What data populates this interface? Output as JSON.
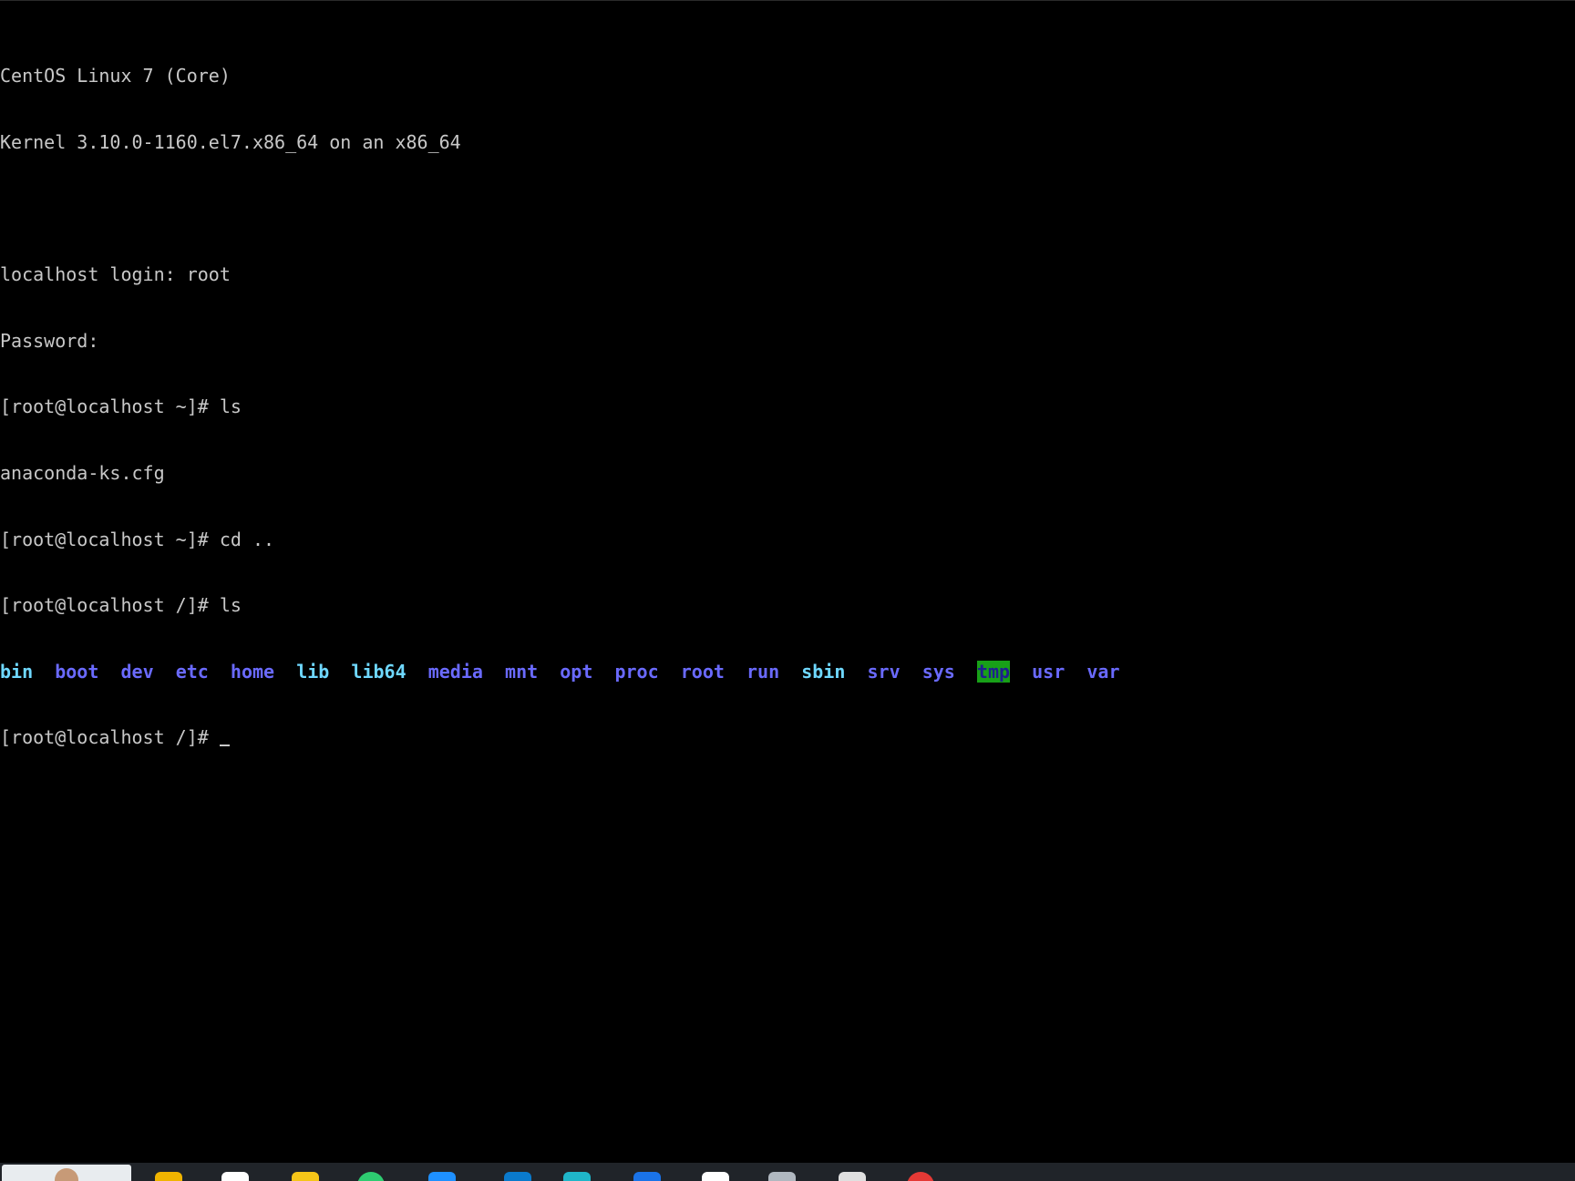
{
  "console": {
    "lines": [
      "CentOS Linux 7 (Core)",
      "Kernel 3.10.0-1160.el7.x86_64 on an x86_64",
      "",
      "localhost login: root",
      "Password:",
      "[root@localhost ~]# ls",
      "anaconda-ks.cfg",
      "[root@localhost ~]# cd ..",
      "[root@localhost /]# ls"
    ],
    "ls_entries": [
      {
        "name": "bin",
        "color": "#6fd8ff"
      },
      {
        "name": "boot",
        "color": "#6a6aff"
      },
      {
        "name": "dev",
        "color": "#6a6aff"
      },
      {
        "name": "etc",
        "color": "#6a6aff"
      },
      {
        "name": "home",
        "color": "#6a6aff"
      },
      {
        "name": "lib",
        "color": "#6fd8ff"
      },
      {
        "name": "lib64",
        "color": "#6fd8ff"
      },
      {
        "name": "media",
        "color": "#6a6aff"
      },
      {
        "name": "mnt",
        "color": "#6a6aff"
      },
      {
        "name": "opt",
        "color": "#6a6aff"
      },
      {
        "name": "proc",
        "color": "#6a6aff"
      },
      {
        "name": "root",
        "color": "#6a6aff"
      },
      {
        "name": "run",
        "color": "#6a6aff"
      },
      {
        "name": "sbin",
        "color": "#6fd8ff"
      },
      {
        "name": "srv",
        "color": "#6a6aff"
      },
      {
        "name": "sys",
        "color": "#6a6aff"
      },
      {
        "name": "tmp",
        "color": "#1f1f8f",
        "background": "#18a018"
      },
      {
        "name": "usr",
        "color": "#6a6aff"
      },
      {
        "name": "var",
        "color": "#6a6aff"
      }
    ],
    "prompt": "[root@localhost /]# "
  },
  "colors": {
    "background": "#000000",
    "text": "#c8c8c8",
    "directory": "#6a6aff",
    "symlink": "#6fd8ff",
    "sticky_dir_bg": "#18a018"
  },
  "taskbar": {
    "icons": [
      {
        "name": "user-thumbnail-icon"
      },
      {
        "name": "file-explorer-icon",
        "color": "#f0b400"
      },
      {
        "name": "app-white-icon",
        "color": "#ffffff"
      },
      {
        "name": "app-star-icon",
        "color": "#f5c518"
      },
      {
        "name": "app-green-icon",
        "color": "#2ecc71"
      },
      {
        "name": "app-blue-icon",
        "color": "#1e90ff"
      },
      {
        "name": "vscode-icon",
        "color": "#0a7acc"
      },
      {
        "name": "app-cube-icon",
        "color": "#1fb6c9"
      },
      {
        "name": "app-mail-icon",
        "color": "#1a73e8"
      },
      {
        "name": "app-chat-icon",
        "color": "#ffffff"
      },
      {
        "name": "app-box-icon",
        "color": "#b0b8c0"
      },
      {
        "name": "app-cat-icon",
        "color": "#e0e0e0"
      },
      {
        "name": "app-red-icon",
        "color": "#e53935"
      }
    ]
  }
}
